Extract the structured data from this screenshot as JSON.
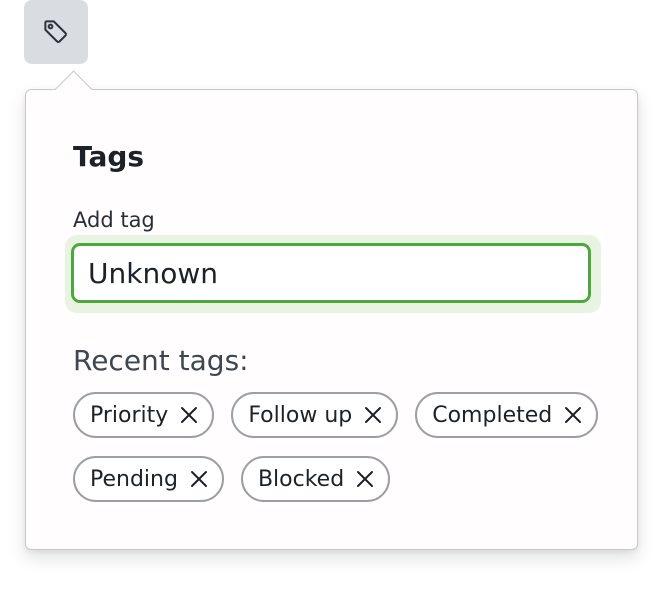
{
  "trigger": {
    "icon": "tag-icon"
  },
  "popover": {
    "title": "Tags",
    "add_tag_label": "Add tag",
    "input_value": "Unknown",
    "recent_heading": "Recent tags:",
    "recent_tags": [
      {
        "label": "Priority",
        "remove_icon": "close-icon"
      },
      {
        "label": "Follow up",
        "remove_icon": "close-icon"
      },
      {
        "label": "Completed",
        "remove_icon": "close-icon"
      },
      {
        "label": "Pending",
        "remove_icon": "close-icon"
      },
      {
        "label": "Blocked",
        "remove_icon": "close-icon"
      }
    ]
  },
  "colors": {
    "trigger_bg": "#d9dde2",
    "input_focus_border": "#4aa93a",
    "input_focus_ring": "#e8f4e1",
    "chip_border": "#9b9ea3"
  }
}
